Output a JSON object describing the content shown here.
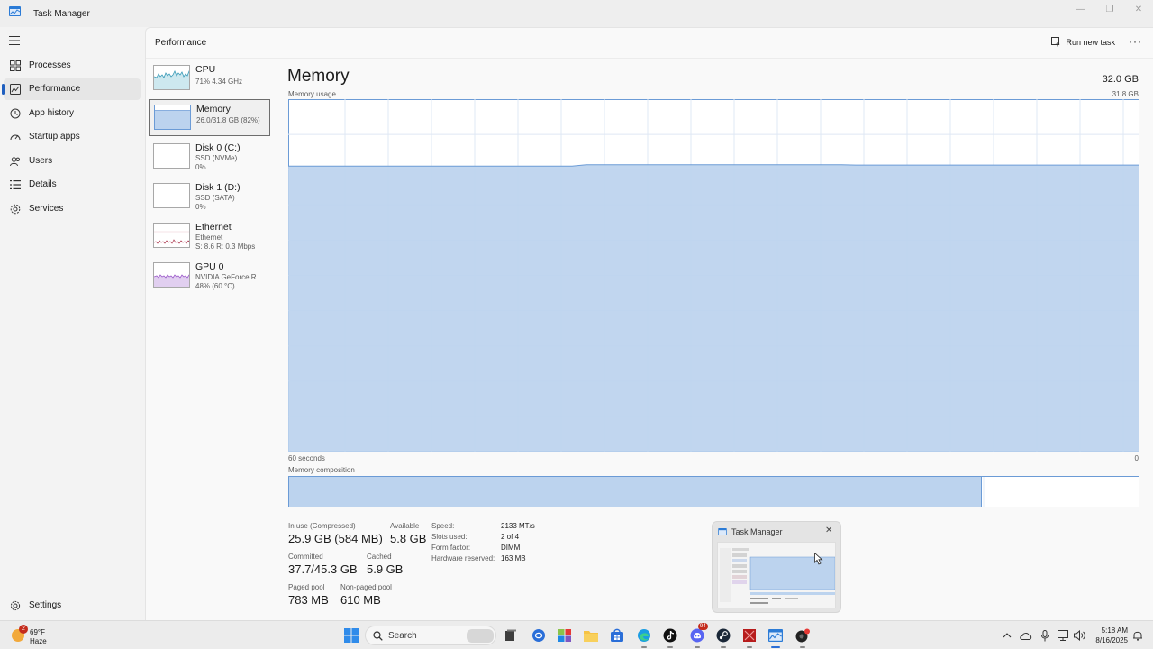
{
  "window": {
    "title": "Task Manager",
    "minimize_glyph": "—",
    "maximize_glyph": "❐",
    "close_glyph": "✕"
  },
  "nav": {
    "items": [
      {
        "label": "Processes",
        "icon": "processes-grid-icon"
      },
      {
        "label": "Performance",
        "icon": "performance-chart-icon",
        "active": true
      },
      {
        "label": "App history",
        "icon": "history-clock-icon"
      },
      {
        "label": "Startup apps",
        "icon": "startup-gauge-icon"
      },
      {
        "label": "Users",
        "icon": "users-icon"
      },
      {
        "label": "Details",
        "icon": "details-list-icon"
      },
      {
        "label": "Services",
        "icon": "services-puzzle-icon"
      }
    ],
    "settings_label": "Settings"
  },
  "header": {
    "title": "Performance",
    "run_new_task": "Run new task",
    "more_glyph": "···"
  },
  "devices": [
    {
      "name": "CPU",
      "line1": "71% 4.34 GHz",
      "line2": ""
    },
    {
      "name": "Memory",
      "line1": "26.0/31.8 GB (82%)",
      "line2": ""
    },
    {
      "name": "Disk 0 (C:)",
      "line1": "SSD (NVMe)",
      "line2": "0%"
    },
    {
      "name": "Disk 1 (D:)",
      "line1": "SSD (SATA)",
      "line2": "0%"
    },
    {
      "name": "Ethernet",
      "line1": "Ethernet",
      "line2": "S: 8.6  R: 0.3 Mbps"
    },
    {
      "name": "GPU 0",
      "line1": "NVIDIA GeForce R...",
      "line2": "48% (60 °C)"
    }
  ],
  "memory": {
    "title": "Memory",
    "total": "32.0 GB",
    "usage_label": "Memory usage",
    "usage_max": "31.8 GB",
    "time_left": "60 seconds",
    "time_right": "0",
    "composition_label": "Memory composition",
    "composition_in_use_fraction": 0.815,
    "usage_level_fraction": 0.81,
    "stats": {
      "in_use_label": "In use (Compressed)",
      "in_use_value": "25.9 GB (584 MB)",
      "available_label": "Available",
      "available_value": "5.8 GB",
      "committed_label": "Committed",
      "committed_value": "37.7/45.3 GB",
      "cached_label": "Cached",
      "cached_value": "5.9 GB",
      "paged_label": "Paged pool",
      "paged_value": "783 MB",
      "nonpaged_label": "Non-paged pool",
      "nonpaged_value": "610 MB"
    },
    "specs": [
      {
        "key": "Speed:",
        "value": "2133 MT/s"
      },
      {
        "key": "Slots used:",
        "value": "2 of 4"
      },
      {
        "key": "Form factor:",
        "value": "DIMM"
      },
      {
        "key": "Hardware reserved:",
        "value": "163 MB"
      }
    ]
  },
  "preview": {
    "title": "Task Manager",
    "close_glyph": "✕"
  },
  "taskbar": {
    "weather_temp": "69°F",
    "weather_cond": "Haze",
    "weather_badge": "2",
    "search_label": "Search",
    "discord_badge": "94",
    "time": "5:18 AM",
    "date": "8/16/2025"
  },
  "colors": {
    "accent": "#1f5fbf",
    "memory_fill": "#bcd3ee",
    "memory_line": "#6b9bd6",
    "cpu_fill": "#cde8ef",
    "cpu_line": "#3a9bb8",
    "eth_line": "#b2475c",
    "gpu_fill": "#e1cff0",
    "gpu_line": "#9a57c9"
  }
}
